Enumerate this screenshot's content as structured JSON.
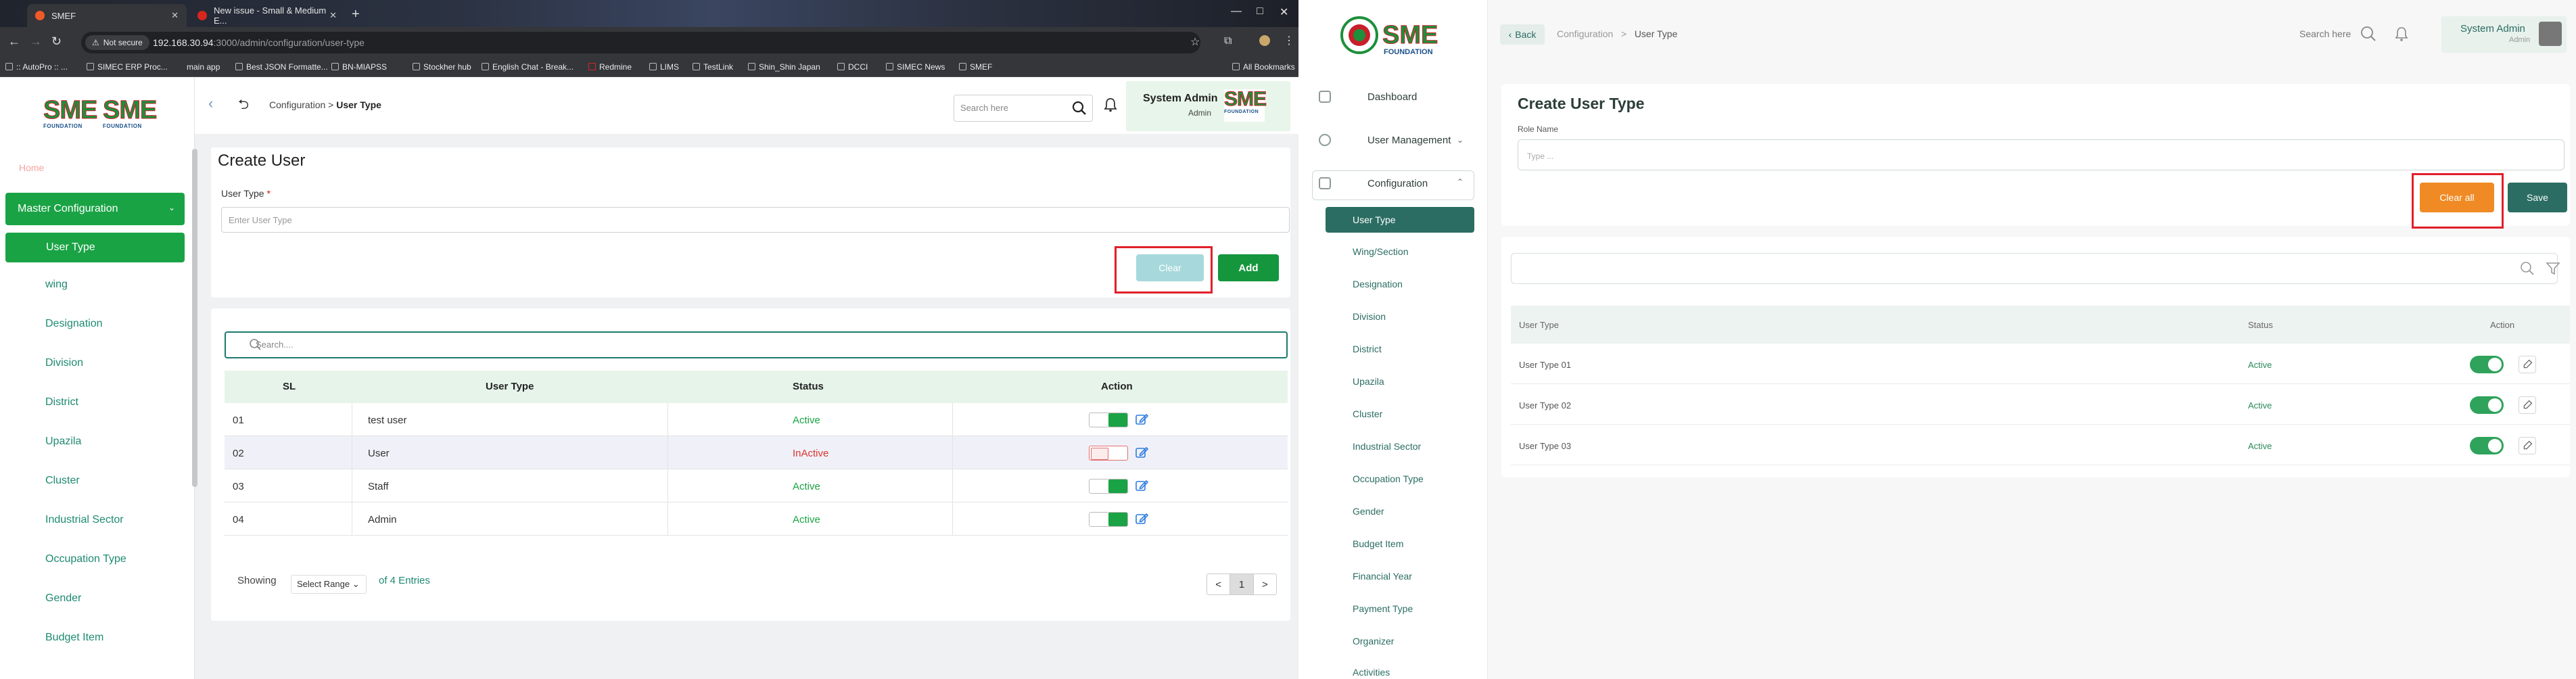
{
  "browser": {
    "tabs": [
      {
        "title": "SMEF",
        "favicon_color": "#f05a28"
      },
      {
        "title": "New issue - Small & Medium E...",
        "favicon_color": "#d7261e"
      }
    ],
    "new_tab": "+",
    "window_controls": {
      "minimize": "—",
      "maximize": "□",
      "close": "✕"
    },
    "security_label": "Not secure",
    "url_host": "192.168.30.94",
    "url_path": ":3000/admin/configuration/user-type",
    "bookmarks": [
      ":: AutoPro :: ...",
      "SIMEC ERP Proc...",
      "main app",
      "Best JSON Formatte...",
      "BN-MIAPSS",
      "Stockher hub",
      "English Chat - Break...",
      "Redmine",
      "LIMS",
      "TestLink",
      "Shin_Shin Japan",
      "DCCI",
      "SIMEC News",
      "SMEF"
    ],
    "all_bookmarks": "All Bookmarks"
  },
  "old_app": {
    "logo": {
      "word": "SME",
      "caption": "FOUNDATION"
    },
    "sidebar": {
      "home": "Home",
      "master_config": "Master Configuration",
      "active_item": "User Type",
      "items": [
        "wing",
        "Designation",
        "Division",
        "District",
        "Upazila",
        "Cluster",
        "Industrial Sector",
        "Occupation Type",
        "Gender",
        "Budget Item"
      ]
    },
    "header": {
      "collapse_icon": "‹",
      "back_icon": "⮌",
      "breadcrumb_parent": "Configuration",
      "breadcrumb_sep": ">",
      "breadcrumb_current": "User Type",
      "search_placeholder": "Search here",
      "user_name": "System Admin",
      "user_role": "Admin"
    },
    "form": {
      "title": "Create User",
      "field_label": "User Type",
      "required_mark": "*",
      "field_placeholder": "Enter User Type",
      "clear_label": "Clear",
      "add_label": "Add"
    },
    "table": {
      "search_placeholder": "Search....",
      "columns": [
        "SL",
        "User Type",
        "Status",
        "Action"
      ],
      "rows": [
        {
          "sl": "01",
          "user_type": "test user",
          "status": "Active",
          "enabled": true
        },
        {
          "sl": "02",
          "user_type": "User",
          "status": "InActive",
          "enabled": false
        },
        {
          "sl": "03",
          "user_type": "Staff",
          "status": "Active",
          "enabled": true
        },
        {
          "sl": "04",
          "user_type": "Admin",
          "status": "Active",
          "enabled": true
        }
      ],
      "showing_label": "Showing",
      "range_select": "Select Range",
      "entries_label": "of 4 Entries",
      "pager": {
        "prev": "<",
        "current": "1",
        "next": ">"
      }
    }
  },
  "new_app": {
    "logo": {
      "word": "SME",
      "caption": "FOUNDATION"
    },
    "sidebar": {
      "dashboard": "Dashboard",
      "user_management": "User Management",
      "configuration": "Configuration",
      "active_item": "User Type",
      "items": [
        "Wing/Section",
        "Designation",
        "Division",
        "District",
        "Upazila",
        "Cluster",
        "Industrial Sector",
        "Occupation Type",
        "Gender",
        "Budget Item",
        "Financial Year",
        "Payment Type",
        "Organizer",
        "Activities"
      ]
    },
    "header": {
      "back_label": "Back",
      "breadcrumb_parent": "Configuration",
      "breadcrumb_sep": ">",
      "breadcrumb_current": "User Type",
      "search_label": "Search here",
      "user_name": "System Admin",
      "user_role": "Admin"
    },
    "form": {
      "title": "Create User Type",
      "field_label": "Role Name",
      "field_placeholder": "Type ...",
      "clear_label": "Clear all",
      "save_label": "Save"
    },
    "table": {
      "columns": [
        "User Type",
        "Status",
        "Action"
      ],
      "rows": [
        {
          "user_type": "User Type 01",
          "status": "Active",
          "enabled": true
        },
        {
          "user_type": "User Type 02",
          "status": "Active",
          "enabled": true
        },
        {
          "user_type": "User Type 03",
          "status": "Active",
          "enabled": true
        }
      ]
    }
  },
  "colors": {
    "old_primary": "#1aa345",
    "old_clear": "#a7d9dc",
    "new_primary": "#2b6d63",
    "new_clear": "#f08a24",
    "highlight": "#e0202a"
  }
}
